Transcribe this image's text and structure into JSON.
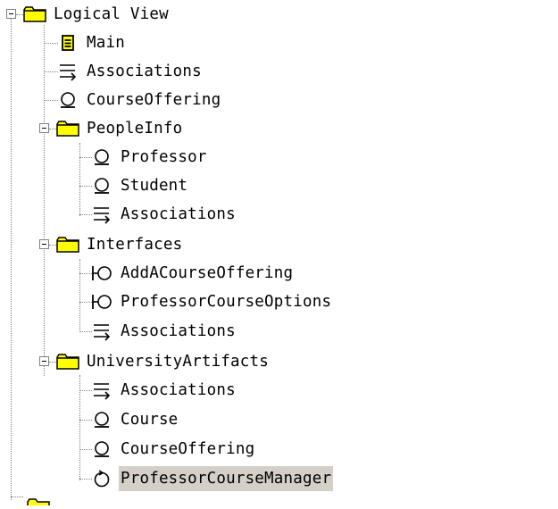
{
  "tree": {
    "root": {
      "label": "Logical View",
      "icon": "folder-icon",
      "expanded": true
    },
    "items": [
      {
        "label": "Main",
        "icon": "class-diagram-icon"
      },
      {
        "label": "Associations",
        "icon": "associations-icon"
      },
      {
        "label": "CourseOffering",
        "icon": "entity-class-icon"
      },
      {
        "label": "PeopleInfo",
        "icon": "folder-icon",
        "expanded": true
      },
      {
        "label": "Professor",
        "icon": "entity-class-icon"
      },
      {
        "label": "Student",
        "icon": "entity-class-icon"
      },
      {
        "label": "Associations",
        "icon": "associations-icon"
      },
      {
        "label": "Interfaces",
        "icon": "folder-icon",
        "expanded": true
      },
      {
        "label": "AddACourseOffering",
        "icon": "boundary-class-icon"
      },
      {
        "label": "ProfessorCourseOptions",
        "icon": "boundary-class-icon"
      },
      {
        "label": "Associations",
        "icon": "associations-icon"
      },
      {
        "label": "UniversityArtifacts",
        "icon": "folder-icon",
        "expanded": true
      },
      {
        "label": "Associations",
        "icon": "associations-icon"
      },
      {
        "label": "Course",
        "icon": "entity-class-icon"
      },
      {
        "label": "CourseOffering",
        "icon": "entity-class-icon"
      },
      {
        "label": "ProfessorCourseManager",
        "icon": "control-class-icon",
        "selected": true
      }
    ]
  },
  "colors": {
    "folder_fill": "#ffff00",
    "folder_stroke": "#000000",
    "selection": "#d4d0c8",
    "tree_lines": "#808080"
  }
}
